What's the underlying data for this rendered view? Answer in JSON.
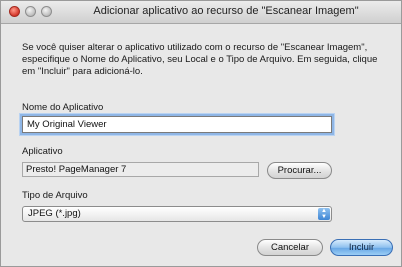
{
  "window": {
    "title": "Adicionar aplicativo ao recurso de \"Escanear Imagem\""
  },
  "dialog": {
    "description": "Se você quiser alterar o aplicativo utilizado com o recurso de \"Escanear Imagem\", especifique o Nome do Aplicativo, seu Local e o Tipo de Arquivo. Em seguida, clique em \"Incluir\" para adicioná-lo.",
    "app_name_label": "Nome do Aplicativo",
    "app_name_value": "My Original Viewer",
    "application_label": "Aplicativo",
    "application_value": "Presto! PageManager 7",
    "browse_button": "Procurar...",
    "file_type_label": "Tipo de Arquivo",
    "file_type_selected": "JPEG (*.jpg)",
    "cancel_button": "Cancelar",
    "include_button": "Incluir"
  },
  "icons": {
    "close": "close-icon",
    "minimize": "minimize-icon",
    "zoom": "zoom-icon",
    "select_arrows": "up-down-arrows-icon"
  },
  "colors": {
    "default_button": "#6aa8e6",
    "close_button": "#d4362a",
    "focus_ring": "#8fb6e6"
  }
}
